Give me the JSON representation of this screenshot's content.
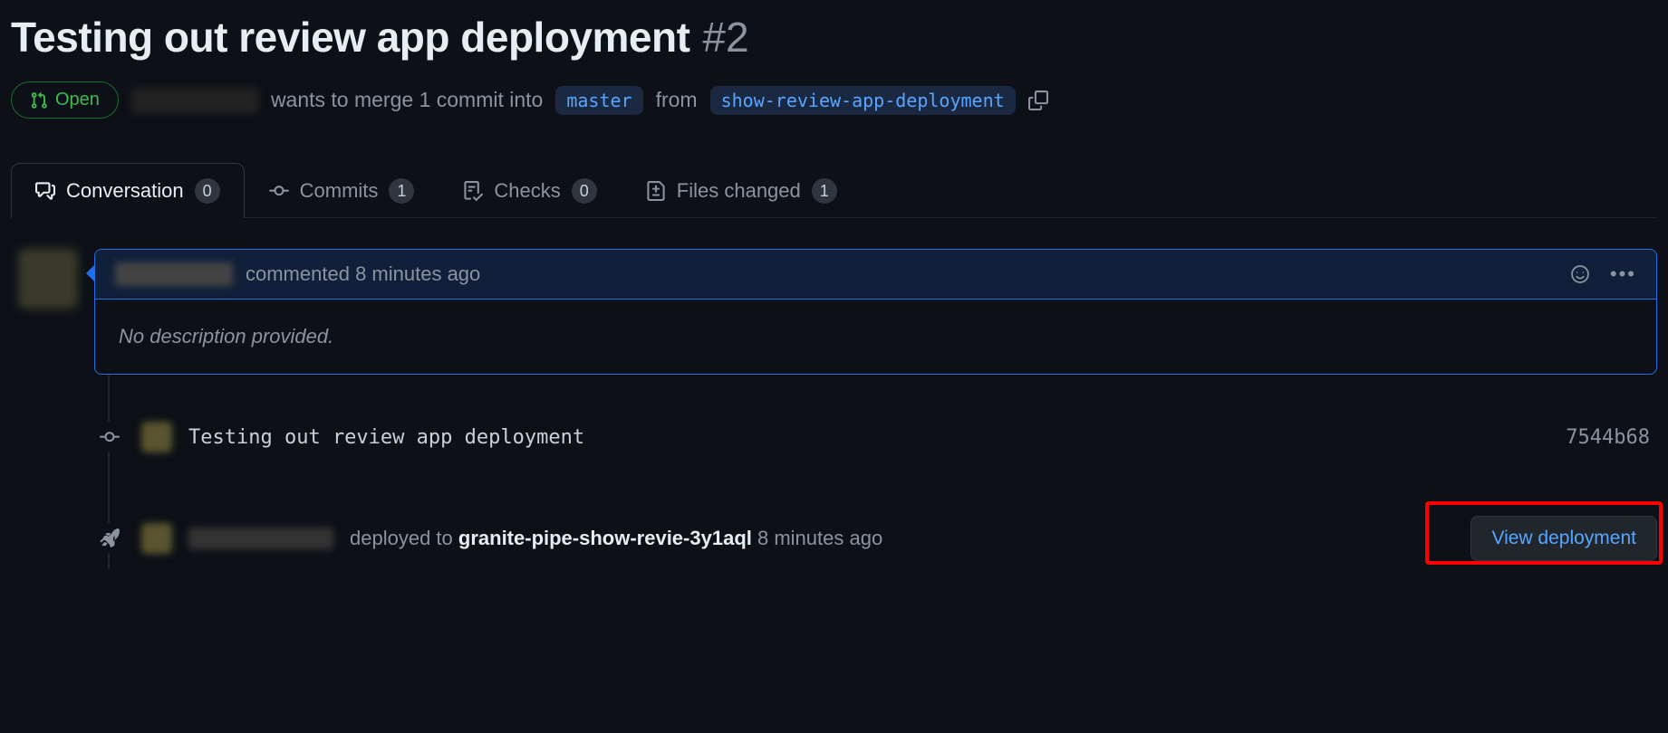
{
  "title": {
    "text": "Testing out review app deployment",
    "number": "#2"
  },
  "state": {
    "label": "Open"
  },
  "meta": {
    "wants_text": "wants to merge 1 commit into",
    "base_branch": "master",
    "from_text": "from",
    "head_branch": "show-review-app-deployment"
  },
  "tabs": {
    "conversation": {
      "label": "Conversation",
      "count": "0"
    },
    "commits": {
      "label": "Commits",
      "count": "1"
    },
    "checks": {
      "label": "Checks",
      "count": "0"
    },
    "files": {
      "label": "Files changed",
      "count": "1"
    }
  },
  "comment": {
    "action": "commented",
    "time": "8 minutes ago",
    "body": "No description provided."
  },
  "commit_event": {
    "message": "Testing out review app deployment",
    "sha": "7544b68"
  },
  "deploy_event": {
    "prefix": "deployed to",
    "env": "granite-pipe-show-revie-3y1aql",
    "time": "8 minutes ago",
    "button": "View deployment"
  }
}
